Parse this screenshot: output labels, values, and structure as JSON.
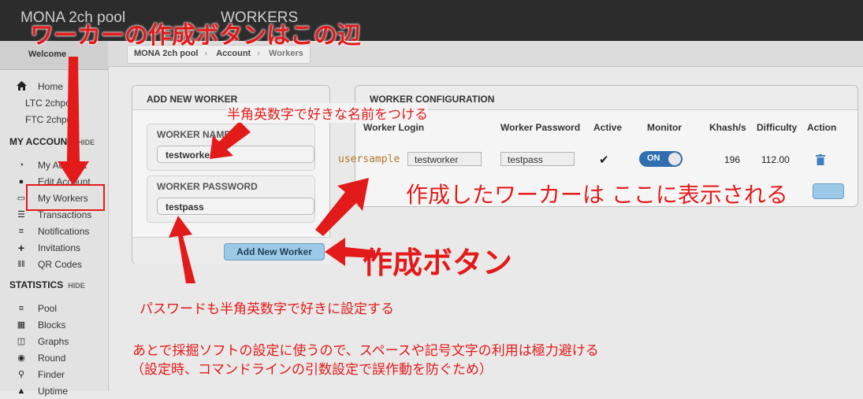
{
  "header": {
    "brand": "MONA 2ch pool",
    "page_title": "WORKERS"
  },
  "sidebar": {
    "welcome": "Welcome",
    "top_items": [
      {
        "label": "Home",
        "icon": "home-icon"
      },
      {
        "label": "LTC 2chpool"
      },
      {
        "label": "FTC 2chpool"
      }
    ],
    "account_section": {
      "title": "MY ACCOUNT",
      "toggle": "HIDE"
    },
    "account_items": [
      {
        "label": "My Account",
        "icon": "dashboard-icon"
      },
      {
        "label": "Edit Account",
        "icon": "user-icon"
      },
      {
        "label": "My Workers",
        "icon": "monitor-icon"
      },
      {
        "label": "Transactions",
        "icon": "list-icon"
      },
      {
        "label": "Notifications",
        "icon": "bars-icon"
      },
      {
        "label": "Invitations",
        "icon": "plus-icon"
      },
      {
        "label": "QR Codes",
        "icon": "barcode-icon"
      }
    ],
    "stats_section": {
      "title": "STATISTICS",
      "toggle": "HIDE"
    },
    "stats_items": [
      {
        "label": "Pool",
        "icon": "lines-icon"
      },
      {
        "label": "Blocks",
        "icon": "grid-icon"
      },
      {
        "label": "Graphs",
        "icon": "graph-icon"
      },
      {
        "label": "Round",
        "icon": "circle-icon"
      },
      {
        "label": "Finder",
        "icon": "search-icon"
      },
      {
        "label": "Uptime",
        "icon": "uptime-icon"
      }
    ]
  },
  "breadcrumb": [
    "MONA 2ch pool",
    "Account",
    "Workers"
  ],
  "add_worker": {
    "title": "ADD NEW WORKER",
    "name_label": "WORKER NAME",
    "name_value": "testworker",
    "password_label": "WORKER PASSWORD",
    "password_value": "testpass",
    "button": "Add New Worker"
  },
  "config": {
    "title": "WORKER CONFIGURATION",
    "columns": [
      "Worker Login",
      "Worker Password",
      "Active",
      "Monitor",
      "Khash/s",
      "Difficulty",
      "Action"
    ],
    "row": {
      "prefix": "usersample",
      "login": "testworker",
      "password": "testpass",
      "active": "✔",
      "monitor": "ON",
      "khash": "196",
      "difficulty": "112.00"
    }
  },
  "annotations": {
    "top": "ワーカーの作成ボタンはこの辺",
    "name_hint": "半角英数字で好きな名前をつける",
    "display_hint": "作成したワーカーは ここに表示される",
    "button_hint": "作成ボタン",
    "password_hint": "パスワードも半角英数字で好きに設定する",
    "note_line1": "あとで採掘ソフトの設定に使うので、スペースや記号文字の利用は極力避ける",
    "note_line2": "（設定時、コマンドラインの引数設定で誤作動を防ぐため）"
  },
  "colors": {
    "annotation": "#e31a1a",
    "toggle": "#2f6fb0",
    "button": "#9cc9e8"
  }
}
